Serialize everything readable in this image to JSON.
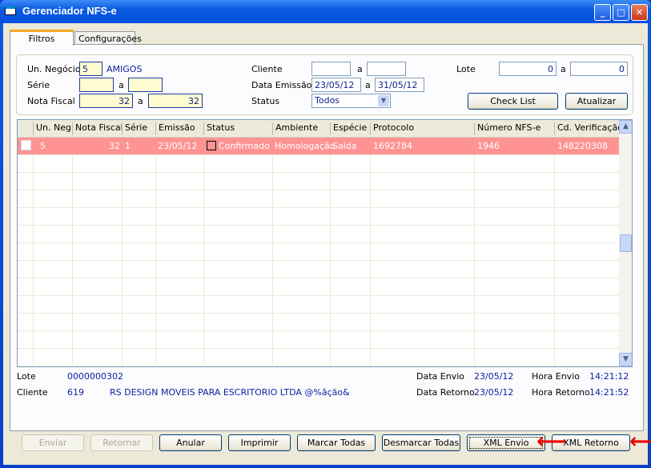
{
  "window": {
    "title": "Gerenciador NFS-e",
    "minimize": "_",
    "maximize": "□",
    "close": "✕"
  },
  "tabs": [
    {
      "label": "Filtros",
      "active": true
    },
    {
      "label": "Configurações",
      "active": false
    }
  ],
  "filters": {
    "un_negocio_label": "Un. Negócio",
    "un_negocio_value": "5",
    "un_negocio_name": "AMIGOS",
    "serie_label": "Série",
    "serie_from": "",
    "serie_to": "",
    "nota_fiscal_label": "Nota Fiscal",
    "nota_from": "32",
    "nota_to": "32",
    "cliente_label": "Cliente",
    "cliente_from": "",
    "cliente_to": "",
    "data_emissao_label": "Data Emissão",
    "data_from": "23/05/12",
    "data_to": "31/05/12",
    "status_label": "Status",
    "status_value": "Todos",
    "lote_label": "Lote",
    "lote_from": "0",
    "lote_to": "0",
    "a": "a"
  },
  "buttons_top": {
    "check_list": "Check List",
    "atualizar": "Atualizar"
  },
  "grid": {
    "columns": [
      "Un. Neg.",
      "Nota Fiscal",
      "Série",
      "Emissão",
      "Status",
      "Ambiente",
      "Espécie",
      "Protocolo",
      "Número NFS-e",
      "Cd. Verificação"
    ],
    "rows": [
      {
        "un_neg": "5",
        "nota_fiscal": "32",
        "serie": "1",
        "emissao": "23/05/12",
        "status": "Confirmado",
        "ambiente": "Homologação",
        "especie": "Saída",
        "protocolo": "1692784",
        "numero_nfse": "1946",
        "cd_verificacao": "148220308",
        "checked": false
      }
    ],
    "row_color": "#ff9393"
  },
  "details": {
    "lote_label": "Lote",
    "lote_value": "0000000302",
    "cliente_label": "Cliente",
    "cliente_code": "619",
    "cliente_name": "RS DESIGN MOVEIS PARA ESCRITORIO LTDA @%âção&",
    "data_envio_label": "Data Envio",
    "data_envio": "23/05/12",
    "hora_envio_label": "Hora Envio",
    "hora_envio": "14:21:12",
    "data_retorno_label": "Data Retorno",
    "data_retorno": "23/05/12",
    "hora_retorno_label": "Hora Retorno",
    "hora_retorno": "14:21:52"
  },
  "buttons_bottom": {
    "enviar": "Enviar",
    "retornar": "Retornar",
    "anular": "Anular",
    "imprimir": "Imprimir",
    "marcar_todas": "Marcar Todas",
    "desmarcar_todas": "Desmarcar Todas",
    "xml_envio": "XML Envio",
    "xml_retorno": "XML Retorno"
  },
  "annotation_color": "#ee0000"
}
